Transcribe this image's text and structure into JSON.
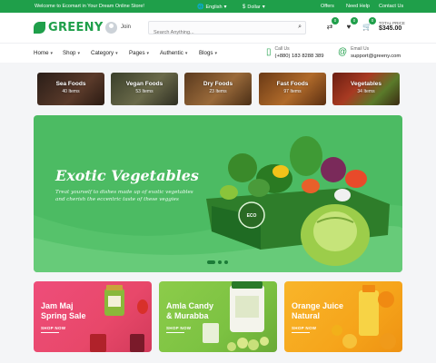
{
  "topbar": {
    "welcome": "Welcome to Ecomart in Your Dream Online Store!",
    "language": "English",
    "currency": "Dollar",
    "links": [
      "Offers",
      "Need Help",
      "Contact Us"
    ]
  },
  "header": {
    "brand": "GREENY",
    "join_label": "Join",
    "search_placeholder": "Search Anything...",
    "compare_count": "0",
    "wishlist_count": "0",
    "cart_count": "0",
    "total_label": "TOTAL PRICE",
    "total_value": "$345.00"
  },
  "nav": {
    "items": [
      "Home",
      "Shop",
      "Category",
      "Pages",
      "Authentic",
      "Blogs"
    ],
    "call_label": "Call Us",
    "call_value": "(+880) 183 8288 389",
    "email_label": "Email Us",
    "email_value": "support@greeny.com"
  },
  "categories": [
    {
      "name": "Sea Foods",
      "count": "40 Items",
      "color": "#3a2a22"
    },
    {
      "name": "Vegan Foods",
      "count": "53 Items",
      "color": "#4a4a3a"
    },
    {
      "name": "Dry Foods",
      "count": "23 Items",
      "color": "#6b4a2a"
    },
    {
      "name": "Fast Foods",
      "count": "97 Items",
      "color": "#7a4a22"
    },
    {
      "name": "Vegetables",
      "count": "34 Items",
      "color": "#5a2a1a"
    }
  ],
  "hero": {
    "title": "Exotic Vegetables",
    "subtitle": "Treat yourself to dishes made up of exotic vegetables and cherish the eccentric taste of these veggies",
    "badge": "ECO"
  },
  "promos": [
    {
      "title_line1": "Jam Maj",
      "title_line2": "Spring Sale",
      "button": "SHOP NOW",
      "color": "#e8486a"
    },
    {
      "title_line1": "Amla Candy",
      "title_line2": "& Murabba",
      "button": "SHOP NOW",
      "color": "#7cc242"
    },
    {
      "title_line1": "Orange Juice",
      "title_line2": "Natural",
      "button": "SHOP NOW",
      "color": "#f6a51b"
    }
  ],
  "colors": {
    "brand": "#1f9f4a",
    "accent": "#1c7c38"
  }
}
